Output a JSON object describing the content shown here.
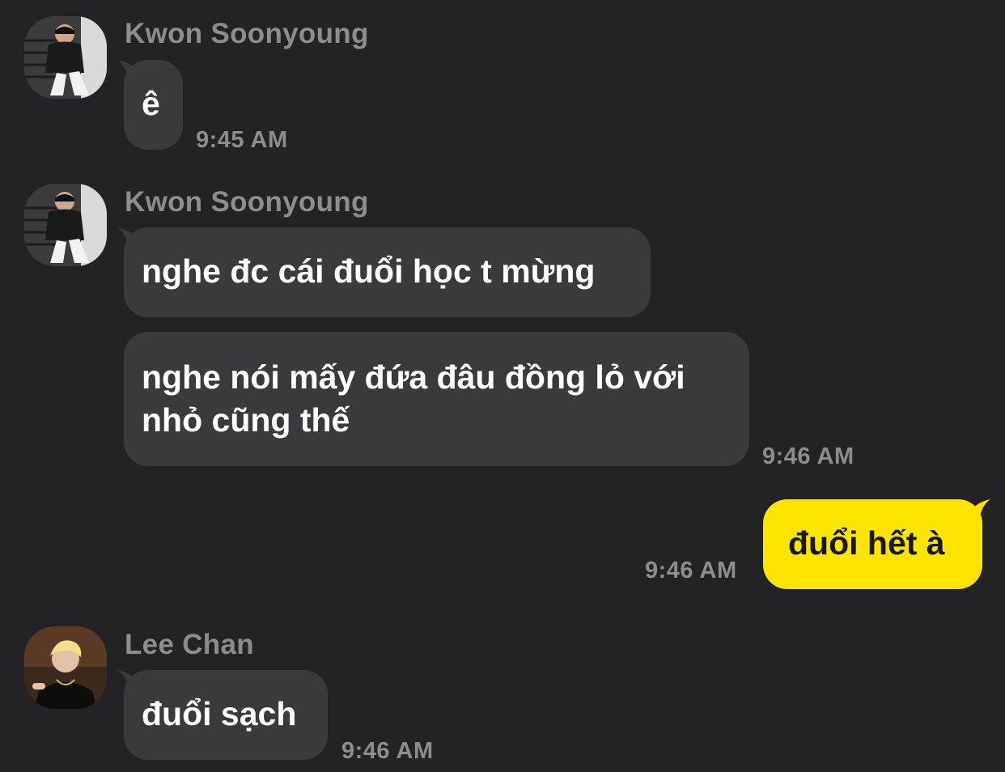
{
  "messages": [
    {
      "sender": "Kwon Soonyoung",
      "avatar": "kwon-soonyoung-avatar",
      "texts": [
        "ê"
      ],
      "time": "9:45 AM"
    },
    {
      "sender": "Kwon Soonyoung",
      "avatar": "kwon-soonyoung-avatar",
      "texts": [
        "nghe đc cái đuổi học t mừng",
        "nghe nói mấy đứa đâu đồng lỏ với",
        "nhỏ cũng thế"
      ],
      "time": "9:46 AM"
    },
    {
      "sender": "me",
      "texts": [
        "đuổi hết à"
      ],
      "time": "9:46 AM"
    },
    {
      "sender": "Lee Chan",
      "avatar": "lee-chan-avatar",
      "texts": [
        "đuổi sạch"
      ],
      "time": "9:46 AM"
    }
  ],
  "colors": {
    "background": "#232325",
    "incoming_bubble": "#3a3a3c",
    "outgoing_bubble": "#fee500",
    "meta_text": "#8d8d91"
  }
}
